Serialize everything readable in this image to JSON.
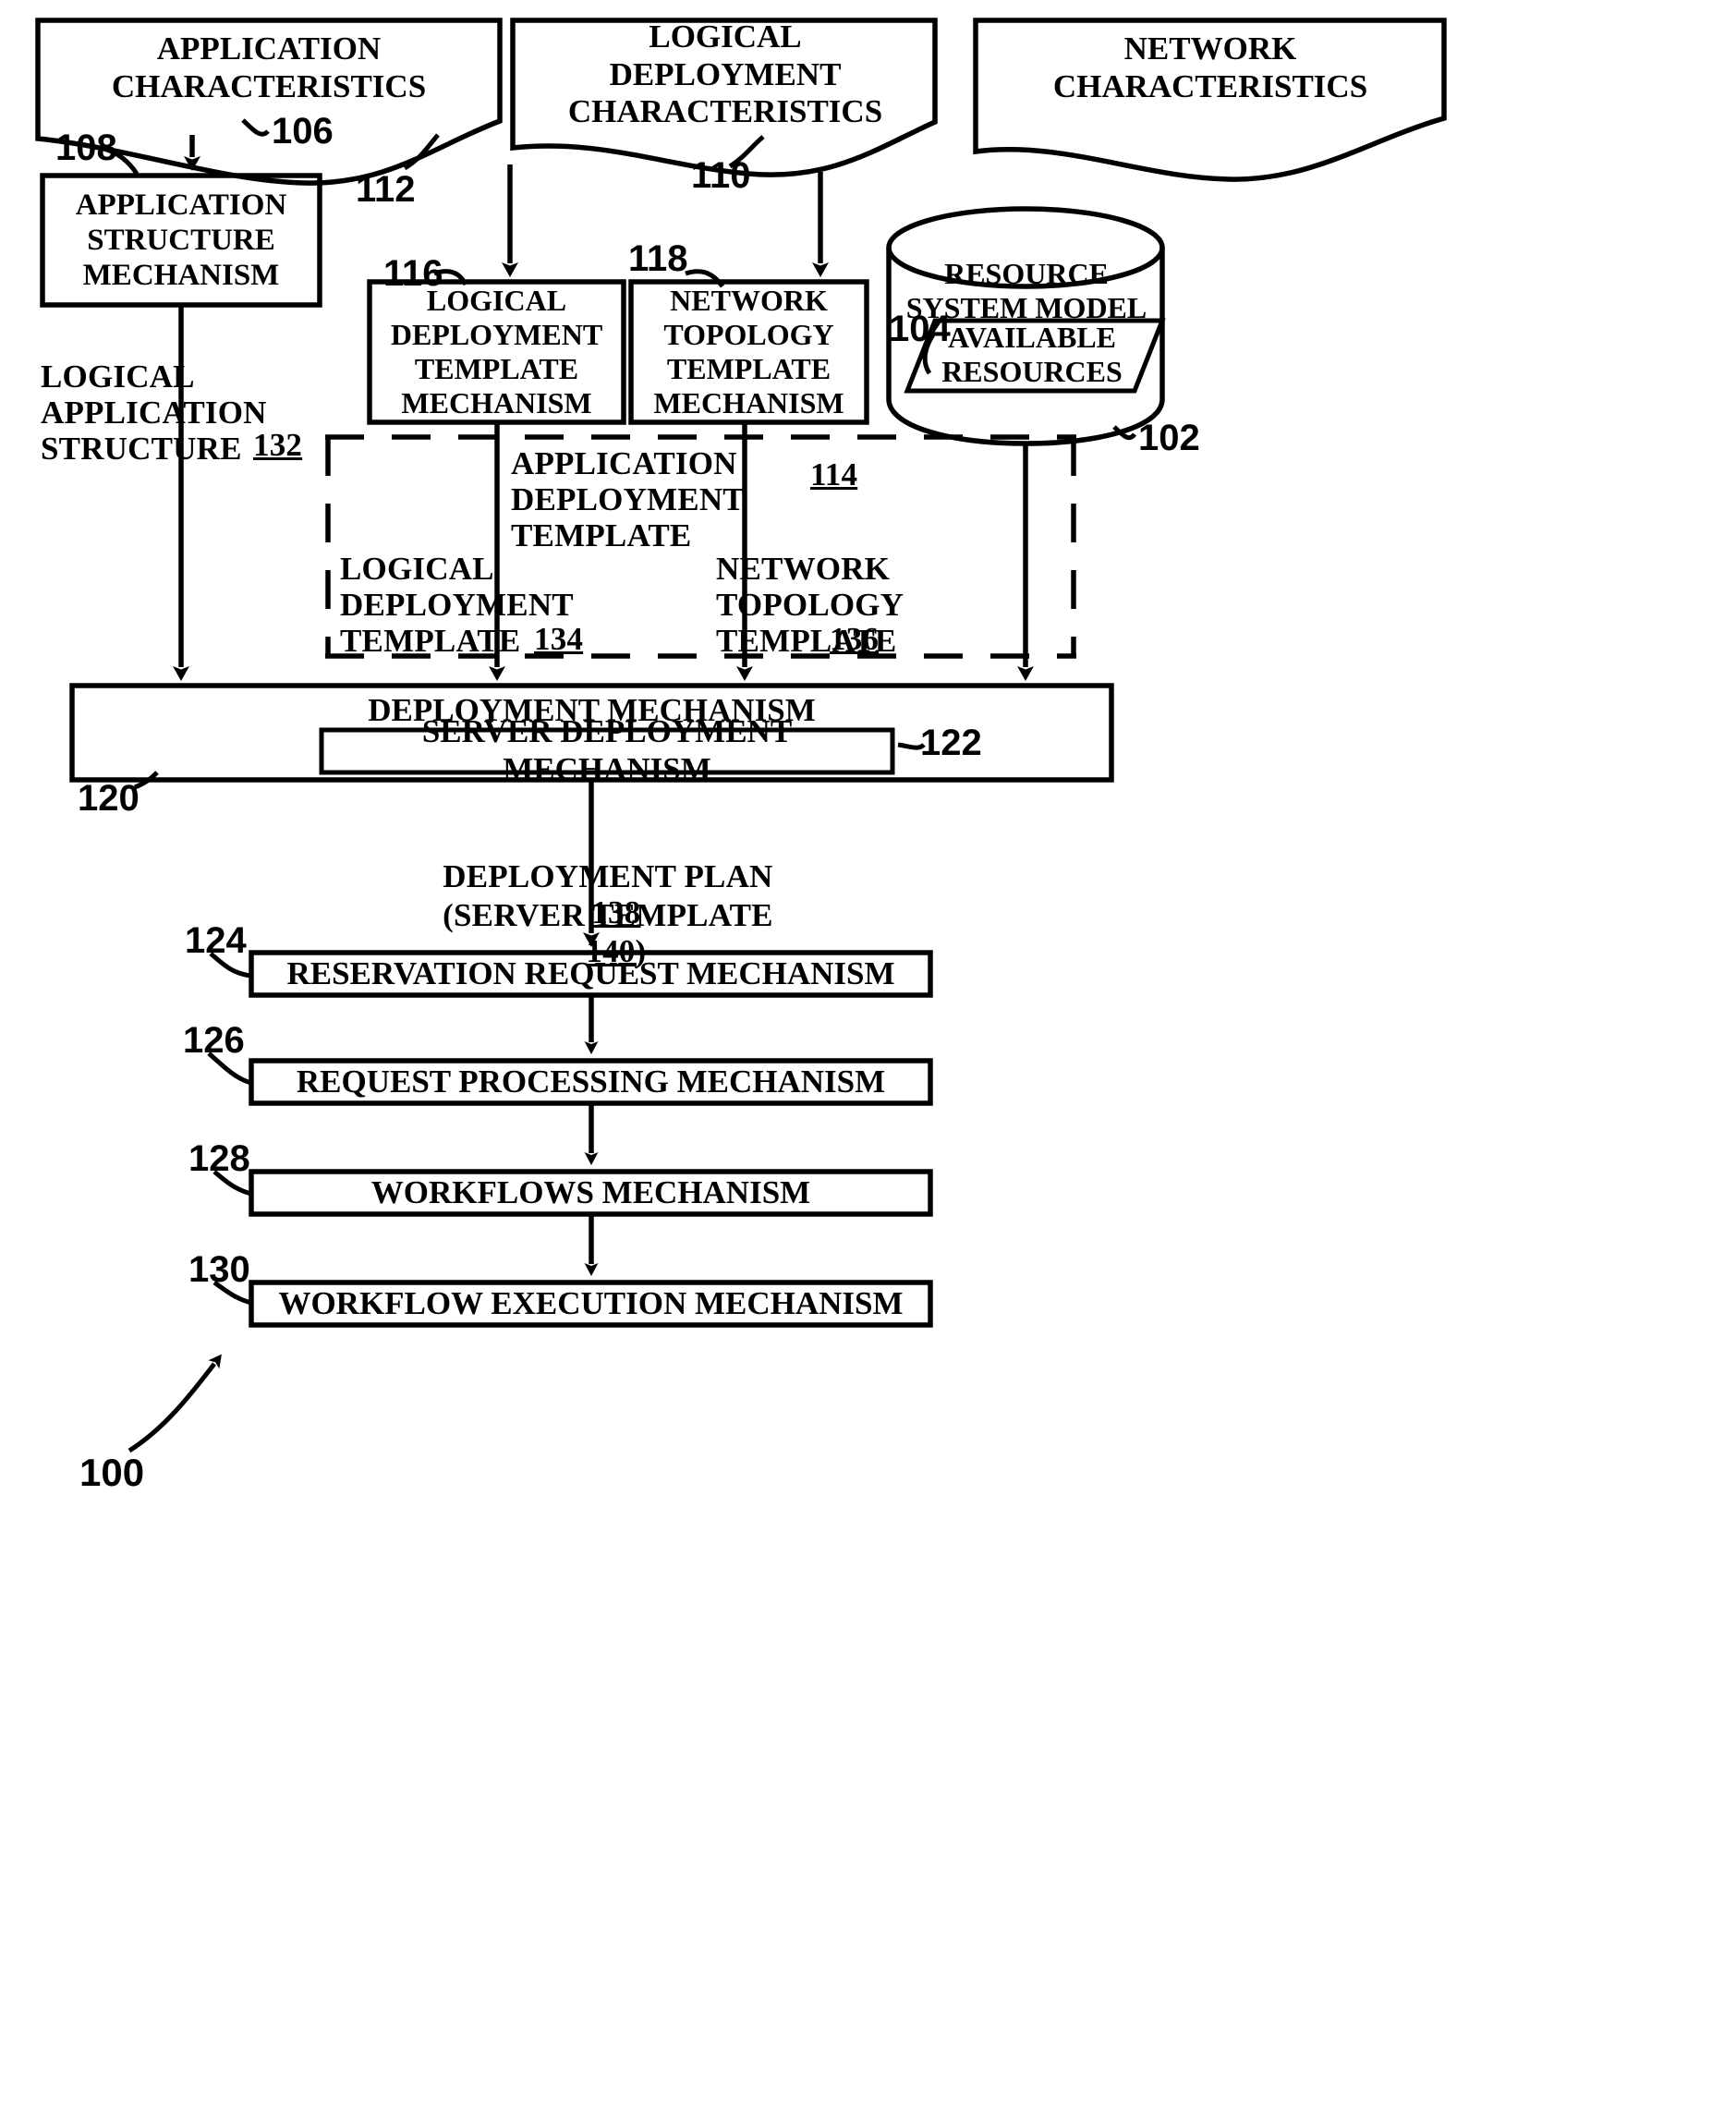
{
  "figure": {
    "figure_ref": "100",
    "doc_sources": [
      {
        "id": "106",
        "label": "APPLICATION\nCHARACTERISTICS"
      },
      {
        "id": "112",
        "label": "LOGICAL\nDEPLOYMENT\nCHARACTERISTICS"
      },
      {
        "id": "110",
        "label": "NETWORK\nCHARACTERISTICS"
      }
    ],
    "mechanisms": [
      {
        "id": "108",
        "label": "APPLICATION\nSTRUCTURE\nMECHANISM"
      },
      {
        "id": "116",
        "label": "LOGICAL\nDEPLOYMENT\nTEMPLATE\nMECHANISM"
      },
      {
        "id": "118",
        "label": "NETWORK\nTOPOLOGY\nTEMPLATE\nMECHANISM"
      }
    ],
    "datastore": {
      "id": "102",
      "label": "RESOURCE\nSYSTEM MODEL",
      "inner": {
        "id": "104",
        "label": "AVAILABLE\nRESOURCES"
      }
    },
    "flow_labels": {
      "logical_application_structure": {
        "text": "LOGICAL\nAPPLICATION\nSTRUCTURE",
        "id": "132"
      },
      "application_deployment_template": {
        "text": "APPLICATION\nDEPLOYMENT\nTEMPLATE",
        "id": "114"
      },
      "logical_deployment_template": {
        "text": "LOGICAL\nDEPLOYMENT\nTEMPLATE",
        "id": "134"
      },
      "network_topology_template": {
        "text": "NETWORK\nTOPOLOGY\nTEMPLATE",
        "id": "136"
      },
      "deployment_plan": {
        "text": "DEPLOYMENT PLAN",
        "id": "138"
      },
      "server_template": {
        "text": "(SERVER TEMPLATE",
        "id": "140",
        "close": ")"
      }
    },
    "deployment": {
      "id": "120",
      "label": "DEPLOYMENT MECHANISM",
      "inner": {
        "id": "122",
        "label": "SERVER DEPLOYMENT MECHANISM"
      }
    },
    "pipeline": [
      {
        "id": "124",
        "label": "RESERVATION REQUEST MECHANISM"
      },
      {
        "id": "126",
        "label": "REQUEST PROCESSING MECHANISM"
      },
      {
        "id": "128",
        "label": "WORKFLOWS MECHANISM"
      },
      {
        "id": "130",
        "label": "WORKFLOW EXECUTION MECHANISM"
      }
    ],
    "colors": {
      "ink": "#000000",
      "paper": "#ffffff"
    }
  }
}
